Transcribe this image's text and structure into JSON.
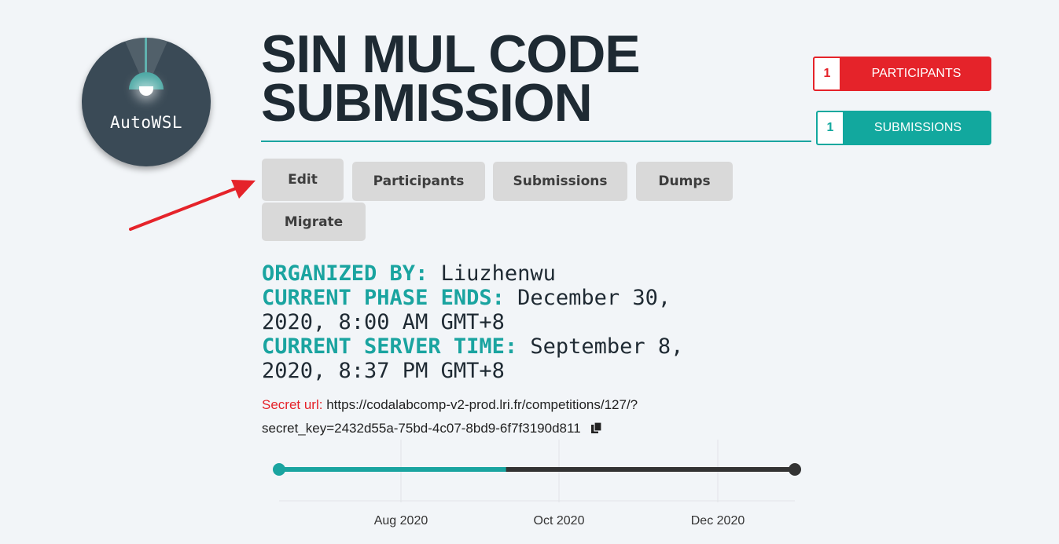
{
  "logo": {
    "text": "AutoWSL",
    "icon": "lamp-icon"
  },
  "title": {
    "line1": "SIN MUL CODE",
    "line2": "SUBMISSION"
  },
  "stats": {
    "participants": {
      "count": "1",
      "label": "PARTICIPANTS"
    },
    "submissions": {
      "count": "1",
      "label": "SUBMISSIONS"
    }
  },
  "tabs": [
    {
      "label": "Edit"
    },
    {
      "label": "Participants"
    },
    {
      "label": "Submissions"
    },
    {
      "label": "Dumps"
    },
    {
      "label": "Migrate"
    }
  ],
  "info": {
    "organized_by": {
      "key": "ORGANIZED BY:",
      "value": "Liuzhenwu"
    },
    "phase_ends": {
      "key": "CURRENT PHASE ENDS:",
      "value": "December 30,",
      "value2": "2020, 8:00 AM GMT+8"
    },
    "server_time": {
      "key": "CURRENT SERVER TIME:",
      "value": "September 8,",
      "value2": "2020, 8:37 PM GMT+8"
    }
  },
  "secret": {
    "label": "Secret url:",
    "url_line1": "https://codalabcomp-v2-prod.lri.fr/competitions/127/?",
    "url_line2": "secret_key=2432d55a-75bd-4c07-8bd9-6f7f3190d811",
    "icon": "copy-icon"
  },
  "timeline": {
    "ticks": [
      "Aug 2020",
      "Oct 2020",
      "Dec 2020"
    ],
    "progress": 0.44,
    "colors": {
      "progress": "#1aa4a0",
      "remaining": "#333333"
    }
  },
  "colors": {
    "accent": "#1aa4a0",
    "red": "#e5232a",
    "teal": "#12a89e"
  }
}
